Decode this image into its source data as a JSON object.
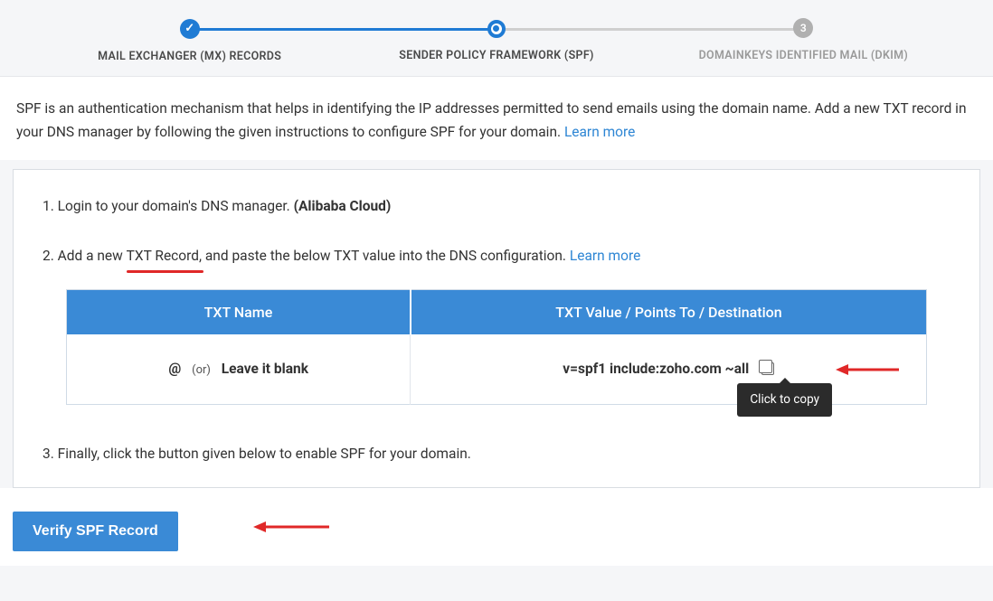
{
  "stepper": {
    "steps": [
      {
        "label": "MAIL EXCHANGER (MX) RECORDS",
        "state": "done"
      },
      {
        "label": "SENDER POLICY FRAMEWORK (SPF)",
        "state": "active"
      },
      {
        "label": "DOMAINKEYS IDENTIFIED MAIL (DKIM)",
        "state": "future",
        "number": "3"
      }
    ]
  },
  "description": {
    "text": "SPF is an authentication mechanism that helps in identifying the IP addresses permitted to send emails using the domain name. Add a new TXT record in your DNS manager by following the given instructions to configure SPF for your domain.  ",
    "learn_more": "Learn more"
  },
  "instructions": {
    "step1_prefix": "1. Login to your domain's DNS manager. ",
    "step1_provider": "(Alibaba Cloud)",
    "step2_prefix": "2. Add a new ",
    "step2_txt_record": "TXT Record,",
    "step2_suffix": " and paste the below TXT value into the DNS configuration. ",
    "step2_learn_more": "Learn more",
    "step3": "3. Finally, click the button given below to enable SPF for your domain."
  },
  "table": {
    "col1_header": "TXT Name",
    "col2_header": "TXT Value / Points To / Destination",
    "row": {
      "at": "@",
      "or": "(or)",
      "blank": "Leave it blank",
      "value": "v=spf1 include:zoho.com ~all"
    },
    "tooltip": "Click to copy"
  },
  "verify": {
    "button": "Verify SPF Record"
  },
  "colors": {
    "accent": "#3a8ad6",
    "red": "#e02828"
  }
}
